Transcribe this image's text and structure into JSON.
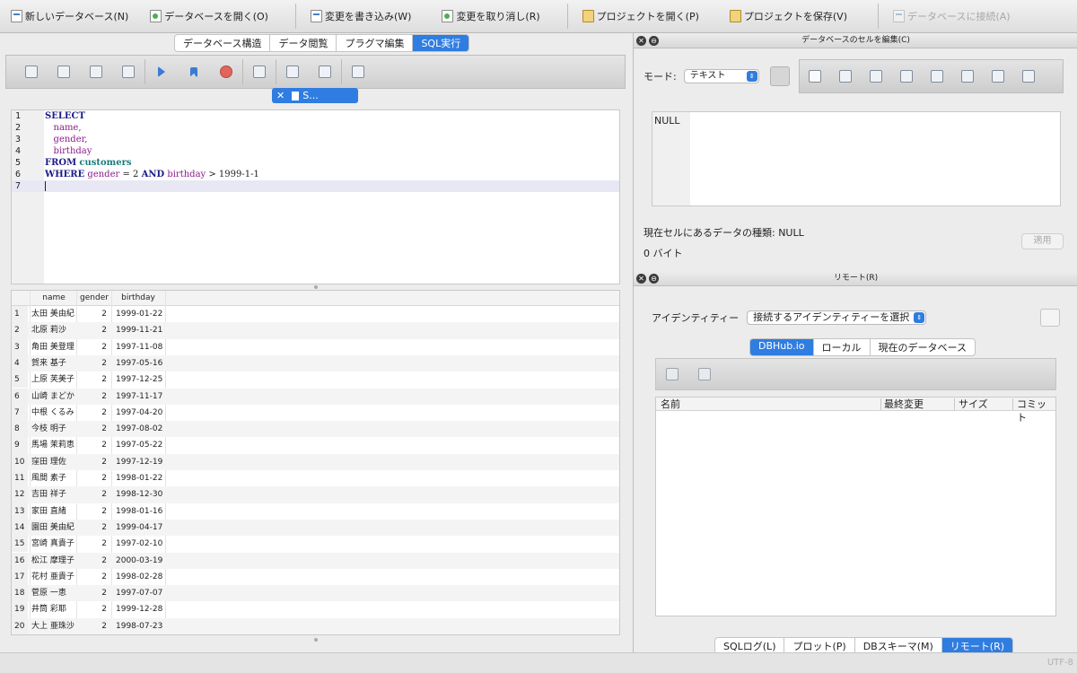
{
  "toolbar": {
    "new_db": "新しいデータベース(N)",
    "open_db": "データベースを開く(O)",
    "write_changes": "変更を書き込み(W)",
    "revert_changes": "変更を取り消し(R)",
    "open_project": "プロジェクトを開く(P)",
    "save_project": "プロジェクトを保存(V)",
    "attach_db": "データベースに接続(A)"
  },
  "main_tabs": [
    "データベース構造",
    "データ閲覧",
    "プラグマ編集",
    "SQL実行"
  ],
  "query_tab": {
    "close": "✕",
    "label": "S..."
  },
  "editor": {
    "lines": [
      {
        "n": "1"
      },
      {
        "n": "2"
      },
      {
        "n": "3"
      },
      {
        "n": "4"
      },
      {
        "n": "5"
      },
      {
        "n": "6"
      },
      {
        "n": "7"
      }
    ],
    "tokens": {
      "select": "SELECT",
      "name": "name,",
      "gender": "gender,",
      "birthday": "birthday",
      "from": "FROM",
      "customers": "customers",
      "where": "WHERE",
      "gender_col": "gender",
      "eq": " = 2 ",
      "and": "AND",
      "birthday_col": "birthday",
      "gt": " > 1999-1-1"
    }
  },
  "results": {
    "headers": [
      "name",
      "gender",
      "birthday"
    ],
    "rows": [
      [
        "1",
        "太田 美由紀",
        "2",
        "1999-01-22"
      ],
      [
        "2",
        "北原 莉沙",
        "2",
        "1999-11-21"
      ],
      [
        "3",
        "角田 美登理",
        "2",
        "1997-11-08"
      ],
      [
        "4",
        "賀来 基子",
        "2",
        "1997-05-16"
      ],
      [
        "5",
        "上原 芙美子",
        "2",
        "1997-12-25"
      ],
      [
        "6",
        "山崎 まどか",
        "2",
        "1997-11-17"
      ],
      [
        "7",
        "中根 くるみ",
        "2",
        "1997-04-20"
      ],
      [
        "8",
        "今枝 明子",
        "2",
        "1997-08-02"
      ],
      [
        "9",
        "馬場 茉莉恵",
        "2",
        "1997-05-22"
      ],
      [
        "10",
        "窪田 理佐",
        "2",
        "1997-12-19"
      ],
      [
        "11",
        "風間 素子",
        "2",
        "1998-01-22"
      ],
      [
        "12",
        "吉田 祥子",
        "2",
        "1998-12-30"
      ],
      [
        "13",
        "家田 直緒",
        "2",
        "1998-01-16"
      ],
      [
        "14",
        "園田 美由紀",
        "2",
        "1999-04-17"
      ],
      [
        "15",
        "宮崎 真貴子",
        "2",
        "1997-02-10"
      ],
      [
        "16",
        "松江 摩理子",
        "2",
        "2000-03-19"
      ],
      [
        "17",
        "花村 亜貴子",
        "2",
        "1998-02-28"
      ],
      [
        "18",
        "菅原 一恵",
        "2",
        "1997-07-07"
      ],
      [
        "19",
        "井筒 彩耶",
        "2",
        "1999-12-28"
      ],
      [
        "20",
        "大上 亜珠沙",
        "2",
        "1998-07-23"
      ]
    ]
  },
  "cell_panel": {
    "title": "データベースのセルを編集(C)",
    "mode_label": "モード:",
    "mode_value": "テキスト",
    "value": "NULL",
    "type_info": "現在セルにあるデータの種類: NULL",
    "size_info": "0 バイト",
    "apply": "適用"
  },
  "remote_panel": {
    "title": "リモート(R)",
    "identity_label": "アイデンティティー",
    "identity_select": "接続するアイデンティティーを選択",
    "tabs": [
      "DBHub.io",
      "ローカル",
      "現在のデータベース"
    ],
    "columns": [
      "名前",
      "最終変更",
      "サイズ",
      "コミット"
    ]
  },
  "bottom_tabs": [
    "SQLログ(L)",
    "プロット(P)",
    "DBスキーマ(M)",
    "リモート(R)"
  ],
  "status": {
    "encoding": "UTF-8"
  },
  "colors": {
    "accent": "#2f7de1",
    "keyword": "#1b1b8a",
    "identifier": "#8b1b8b",
    "table": "#1b7a7a"
  }
}
